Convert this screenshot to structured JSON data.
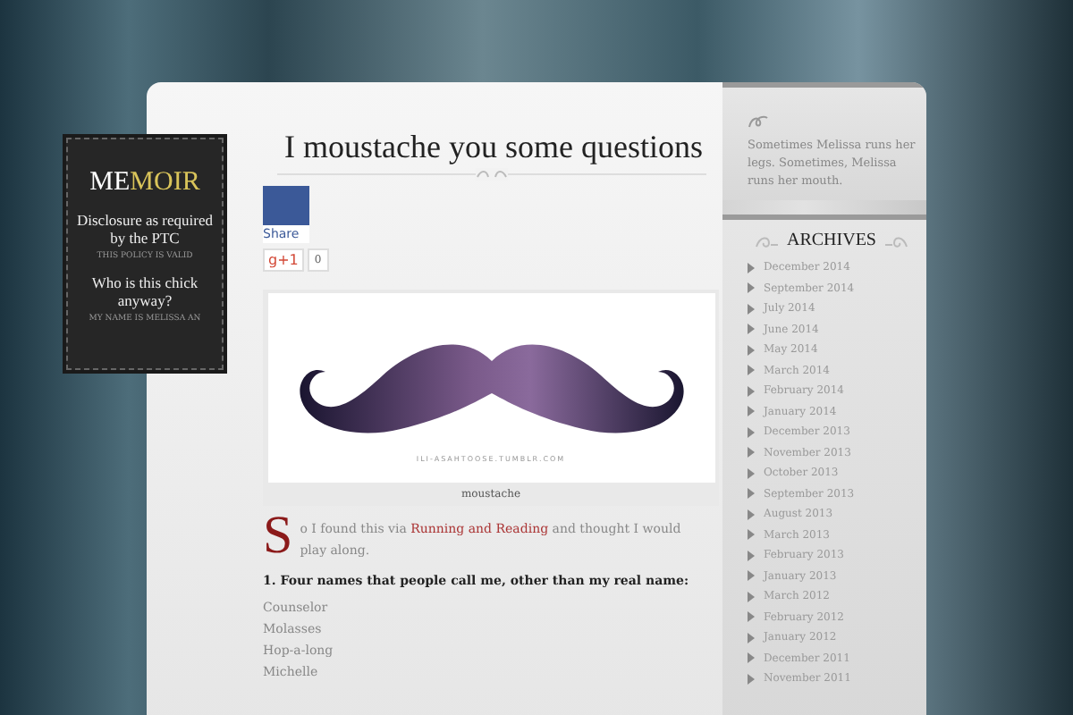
{
  "badge": {
    "logo_part_1": "ME",
    "logo_part_2": "MOIR",
    "links": [
      {
        "title": "Disclosure as required by the PTC",
        "subtitle": "THIS POLICY IS VALID"
      },
      {
        "title": "Who is this chick anyway?",
        "subtitle": "MY NAME IS MELISSA AN"
      }
    ]
  },
  "post": {
    "title": "I moustache you some questions",
    "share": {
      "label": "Share",
      "gplus": "g+1",
      "count": "0"
    },
    "image": {
      "caption": "moustache",
      "watermark": "ILI-ASAHTOOSE.TUMBLR.COM"
    },
    "intro": {
      "drop_cap": "S",
      "before": "o I found this via ",
      "link": "Running and Reading",
      "after": " and thought I would play along."
    },
    "question": "1. Four names that people call me, other than my real name:",
    "answers": [
      "Counselor",
      "Molasses",
      "Hop-a-long",
      "Michelle"
    ]
  },
  "sidebar": {
    "quote": "Sometimes Melissa runs her legs. Sometimes, Melissa runs her mouth.",
    "archives_title": "ARCHIVES",
    "archives": [
      "December 2014",
      "September 2014",
      "July 2014",
      "June 2014",
      "May 2014",
      "March 2014",
      "February 2014",
      "January 2014",
      "December 2013",
      "November 2013",
      "October 2013",
      "September 2013",
      "August 2013",
      "March 2013",
      "February 2013",
      "January 2013",
      "March 2012",
      "February 2012",
      "January 2012",
      "December 2011",
      "November 2011"
    ]
  }
}
